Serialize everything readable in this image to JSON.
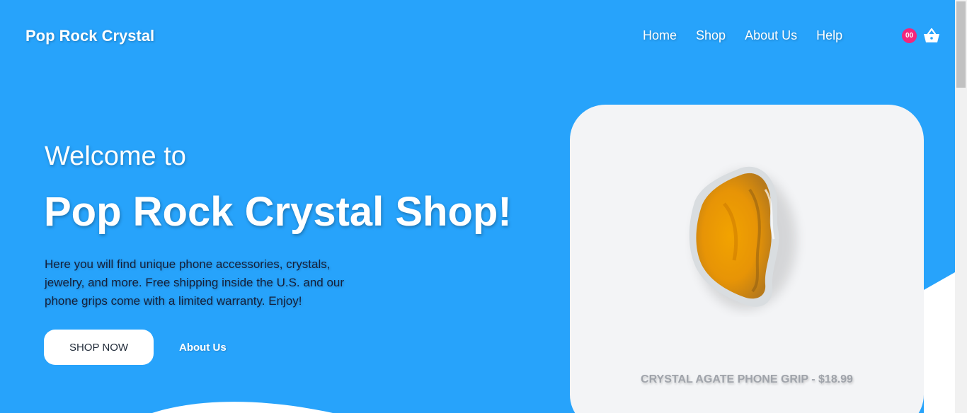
{
  "brand": {
    "name": "Pop Rock Crystal"
  },
  "nav": {
    "items": [
      {
        "label": "Home"
      },
      {
        "label": "Shop"
      },
      {
        "label": "About Us"
      },
      {
        "label": "Help"
      }
    ]
  },
  "cart": {
    "count": "00",
    "icon": "basket-icon"
  },
  "hero": {
    "welcome": "Welcome to",
    "headline": "Pop Rock Crystal Shop!",
    "description": "Here you will find unique phone accessories, crystals, jewelry, and more. Free shipping inside the U.S. and our phone grips come with a limited warranty. Enjoy!",
    "primary_button": "SHOP NOW",
    "secondary_link": "About Us"
  },
  "product": {
    "name": "CRYSTAL AGATE PHONE GRIP - $18.99"
  },
  "colors": {
    "hero_background": "#27a3fb",
    "card_background": "#f3f4f6",
    "badge": "#f3267b"
  }
}
